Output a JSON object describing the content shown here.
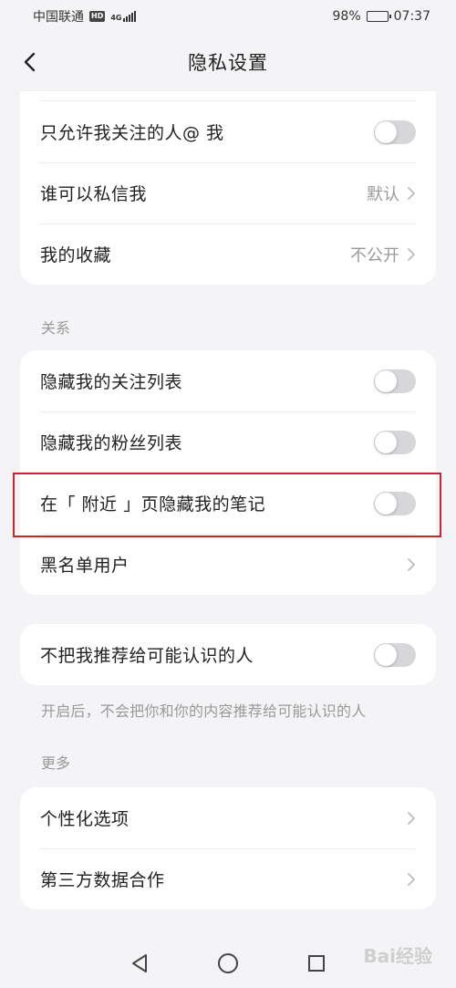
{
  "status": {
    "carrier": "中国联通",
    "hd": "HD",
    "network": "4G",
    "battery": "98%",
    "battery_level": 0.98,
    "time": "07:37"
  },
  "header": {
    "title": "隐私设置"
  },
  "card_top": {
    "items": [
      {
        "label": "只允许我关注的人@ 我",
        "type": "toggle",
        "on": false
      },
      {
        "label": "谁可以私信我",
        "value": "默认",
        "type": "link"
      },
      {
        "label": "我的收藏",
        "value": "不公开",
        "type": "link"
      }
    ]
  },
  "section_relation": {
    "title": "关系",
    "items": [
      {
        "label": "隐藏我的关注列表",
        "type": "toggle",
        "on": false
      },
      {
        "label": "隐藏我的粉丝列表",
        "type": "toggle",
        "on": false
      },
      {
        "label": "在「 附近 」页隐藏我的笔记",
        "type": "toggle",
        "on": false
      },
      {
        "label": "黑名单用户",
        "type": "link"
      }
    ]
  },
  "recommend": {
    "label": "不把我推荐给可能认识的人",
    "on": false,
    "hint": "开启后，不会把你和你的内容推荐给可能认识的人"
  },
  "section_more": {
    "title": "更多",
    "items": [
      {
        "label": "个性化选项",
        "type": "link"
      },
      {
        "label": "第三方数据合作",
        "type": "link"
      }
    ]
  },
  "watermark": "Bai经验",
  "colors": {
    "background": "#f4f4f6",
    "card": "#ffffff",
    "toggle_off": "#d7d7d9",
    "highlight": "#c8262d",
    "secondary_text": "#999999"
  }
}
